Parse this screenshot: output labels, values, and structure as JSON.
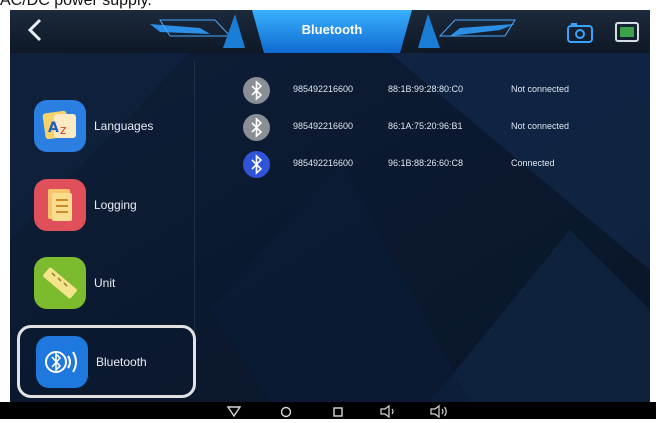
{
  "caption": "AC/DC power supply.",
  "header": {
    "title": "Bluetooth",
    "back_icon": "back-arrow-icon",
    "camera_icon": "screenshot-camera-icon",
    "vci_icon": "vci-connector-icon"
  },
  "sidebar": {
    "items": [
      {
        "label": "Languages",
        "icon": "languages-icon"
      },
      {
        "label": "Logging",
        "icon": "logging-icon"
      },
      {
        "label": "Unit",
        "icon": "unit-ruler-icon"
      },
      {
        "label": "Bluetooth",
        "icon": "bluetooth-icon",
        "selected": true
      }
    ]
  },
  "devices": [
    {
      "name": "985492216600",
      "mac": "88:1B:99:28:80:C0",
      "status": "Not connected"
    },
    {
      "name": "985492216600",
      "mac": "86:1A:75:20:96:B1",
      "status": "Not connected"
    },
    {
      "name": "985492216600",
      "mac": "96:1B:88:26:60:C8",
      "status": "Connected"
    }
  ],
  "navbar": {
    "buttons": [
      "nav-back-icon",
      "nav-home-icon",
      "nav-recent-icon",
      "volume-down-icon",
      "volume-up-icon"
    ]
  },
  "colors": {
    "accent": "#1e88e5",
    "connected_badge": "#2f54d8",
    "disconnected_badge": "#8a8f96",
    "background": "#0d1b2f"
  }
}
